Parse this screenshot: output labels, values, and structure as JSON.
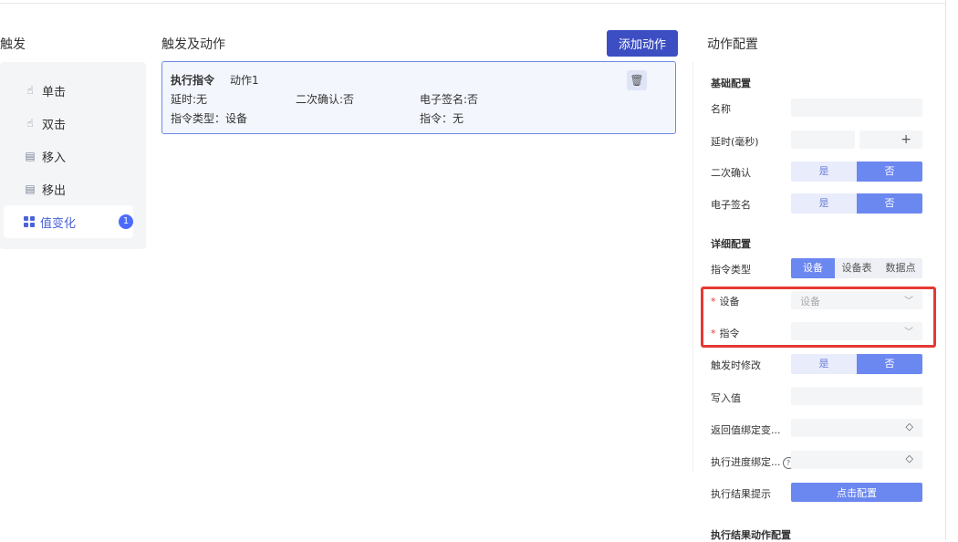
{
  "triggers": {
    "title": "触发",
    "items": [
      {
        "label": "单击",
        "icon": "pointer-icon"
      },
      {
        "label": "双击",
        "icon": "pointer-icon"
      },
      {
        "label": "移入",
        "icon": "doc-icon"
      },
      {
        "label": "移出",
        "icon": "doc-icon"
      },
      {
        "label": "值变化",
        "icon": "grid-icon",
        "badge": "1"
      }
    ]
  },
  "actions": {
    "title": "触发及动作",
    "add_label": "添加动作",
    "card": {
      "type": "执行指令",
      "name": "动作1",
      "delay": "延时:无",
      "confirm": "二次确认:否",
      "signature": "电子签名:否",
      "cmd_type": "指令类型：设备",
      "cmd": "指令：无"
    }
  },
  "config": {
    "title": "动作配置",
    "basic_title": "基础配置",
    "name_label": "名称",
    "delay_label": "延时(毫秒)",
    "plus": "+",
    "confirm_label": "二次确认",
    "signature_label": "电子签名",
    "yes": "是",
    "no": "否",
    "detail_title": "详细配置",
    "cmd_type_label": "指令类型",
    "cmd_types": [
      "设备",
      "设备表",
      "数据点"
    ],
    "required_mark": "*",
    "device_label": "设备",
    "device_placeholder": "设备",
    "cmd_label": "指令",
    "modify_label": "触发时修改",
    "write_label": "写入值",
    "return_bind_label": "返回值绑定变...",
    "progress_bind_label": "执行进度绑定...",
    "help": "?",
    "result_tip_label": "执行结果提示",
    "result_tip_button": "点击配置",
    "result_action_title": "执行结果动作配置"
  }
}
